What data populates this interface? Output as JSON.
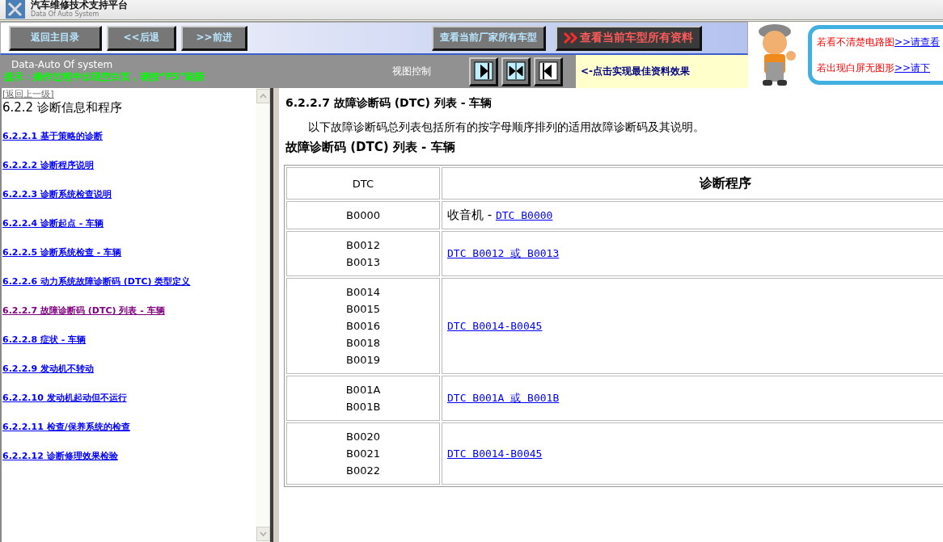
{
  "header": {
    "title": "汽车维修技术支持平台",
    "subtitle": "Data Of Auto System"
  },
  "toolbar": {
    "nav_buttons": [
      "返回主目录",
      "<<后退",
      ">>前进"
    ],
    "model_buttons": [
      {
        "label": "查看当前厂家所有车型",
        "kind": "plain"
      },
      {
        "label": "查看当前车型所有资料",
        "kind": "featured"
      }
    ]
  },
  "status": {
    "brand": "Data-Auto Of system",
    "hint": "提示：操作过程中出现空白页，请按“F5”刷新",
    "view_control_label": "视图控制",
    "view_hint": "<-点击实现最佳资料效果"
  },
  "notice": [
    {
      "text": "若看不清楚电路图",
      "link": ">>请查看"
    },
    {
      "text": "若出现白屏无图形",
      "link": ">>请下"
    }
  ],
  "sidebar": {
    "back_link": "[返回上一级]",
    "heading": "6.2.2 诊断信息和程序",
    "items": [
      {
        "label": "6.2.2.1 基于策略的诊断",
        "visited": false
      },
      {
        "label": "6.2.2.2 诊断程序说明",
        "visited": false
      },
      {
        "label": "6.2.2.3 诊断系统检查说明",
        "visited": false
      },
      {
        "label": "6.2.2.4 诊断起点 - 车辆",
        "visited": false
      },
      {
        "label": "6.2.2.5 诊断系统检查 - 车辆",
        "visited": false
      },
      {
        "label": "6.2.2.6 动力系统故障诊断码 (DTC) 类型定义",
        "visited": false
      },
      {
        "label": "6.2.2.7 故障诊断码 (DTC) 列表 - 车辆",
        "visited": true
      },
      {
        "label": "6.2.2.8 症状 - 车辆",
        "visited": false
      },
      {
        "label": "6.2.2.9 发动机不转动",
        "visited": false
      },
      {
        "label": "6.2.2.10 发动机起动但不运行",
        "visited": false
      },
      {
        "label": "6.2.2.11 检查/保养系统的检查",
        "visited": false
      },
      {
        "label": "6.2.2.12 诊断修理效果检验",
        "visited": false
      }
    ]
  },
  "content": {
    "title": "6.2.2.7 故障诊断码 (DTC) 列表 - 车辆",
    "intro": "以下故障诊断码总列表包括所有的按字母顺序排列的适用故障诊断码及其说明。",
    "table_title": "故障诊断码 (DTC) 列表 - 车辆",
    "table": {
      "columns": [
        "DTC",
        "诊断程序"
      ],
      "rows": [
        {
          "codes": [
            "B0000"
          ],
          "prefix": "收音机 - ",
          "link": "DTC B0000"
        },
        {
          "codes": [
            "B0012",
            "B0013"
          ],
          "link": "DTC B0012 或 B0013"
        },
        {
          "codes": [
            "B0014",
            "B0015",
            "B0016",
            "B0018",
            "B0019"
          ],
          "link": "DTC B0014-B0045"
        },
        {
          "codes": [
            "B001A",
            "B001B"
          ],
          "link": "DTC B001A 或 B001B"
        },
        {
          "codes": [
            "B0020",
            "B0021",
            "B0022"
          ],
          "link": "DTC B0014-B0045"
        }
      ]
    }
  }
}
